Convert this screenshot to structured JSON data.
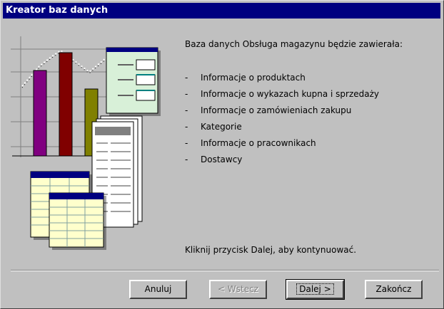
{
  "window": {
    "title": "Kreator baz danych"
  },
  "content": {
    "intro": "Baza danych Obsługa magazynu będzie zawierała:",
    "items": [
      "Informacje o produktach",
      "Informacje o wykazach kupna i sprzedaży",
      "Informacje o zamówieniach zakupu",
      "Kategorie",
      "Informacje o pracownikach",
      "Dostawcy"
    ],
    "dash": "-",
    "footer": "Kliknij przycisk Dalej, aby kontynuować."
  },
  "buttons": {
    "cancel": "Anuluj",
    "back": "< Wstecz",
    "next": "Dalej >",
    "finish": "Zakończ"
  },
  "colors": {
    "titlebar": "#000080",
    "face": "#c0c0c0",
    "bar_purple": "#800080",
    "bar_red": "#800000",
    "bar_olive": "#808000",
    "teal": "#008080",
    "table_header": "#000080",
    "doc_background": "#ffffcc"
  }
}
